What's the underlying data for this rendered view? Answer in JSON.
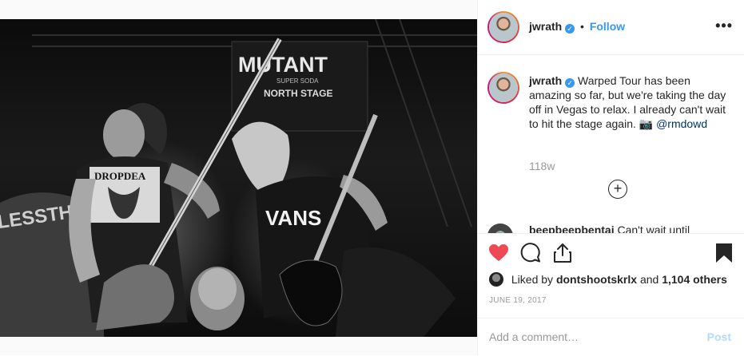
{
  "post": {
    "image_alt": "",
    "stage_sign": {
      "brand": "MUTANT",
      "sub": "SUPER SODA",
      "stage": "NORTH STAGE"
    },
    "shirt_text_left": "DROPDEA",
    "shirt_text_right": "VANS",
    "banner_text": "LESSTHA"
  },
  "header": {
    "username": "jwrath",
    "verified_icon": "verified-badge-icon",
    "separator": "•",
    "follow_label": "Follow",
    "more_label": "•••"
  },
  "caption": {
    "username": "jwrath",
    "text": "Warped Tour has been amazing so far, but we're taking the day off in Vegas to relax. I already can't wait to hit the stage again. 📷",
    "mention": "@rmdowd",
    "time_ago": "118w",
    "load_more_label": "+"
  },
  "partial_comment": {
    "username": "beepbeepbentai",
    "text": "Can't wait until"
  },
  "actions": {
    "like_icon": "heart-filled-icon",
    "comment_icon": "comment-icon",
    "share_icon": "share-icon",
    "save_icon": "bookmark-filled-icon",
    "like_color": "#ed4956"
  },
  "likes": {
    "prefix": "Liked by",
    "user": "dontshootskrlx",
    "conjunction": "and",
    "count": "1,104 others"
  },
  "date": "JUNE 19, 2017",
  "comment_box": {
    "placeholder": "Add a comment…",
    "post_label": "Post"
  }
}
